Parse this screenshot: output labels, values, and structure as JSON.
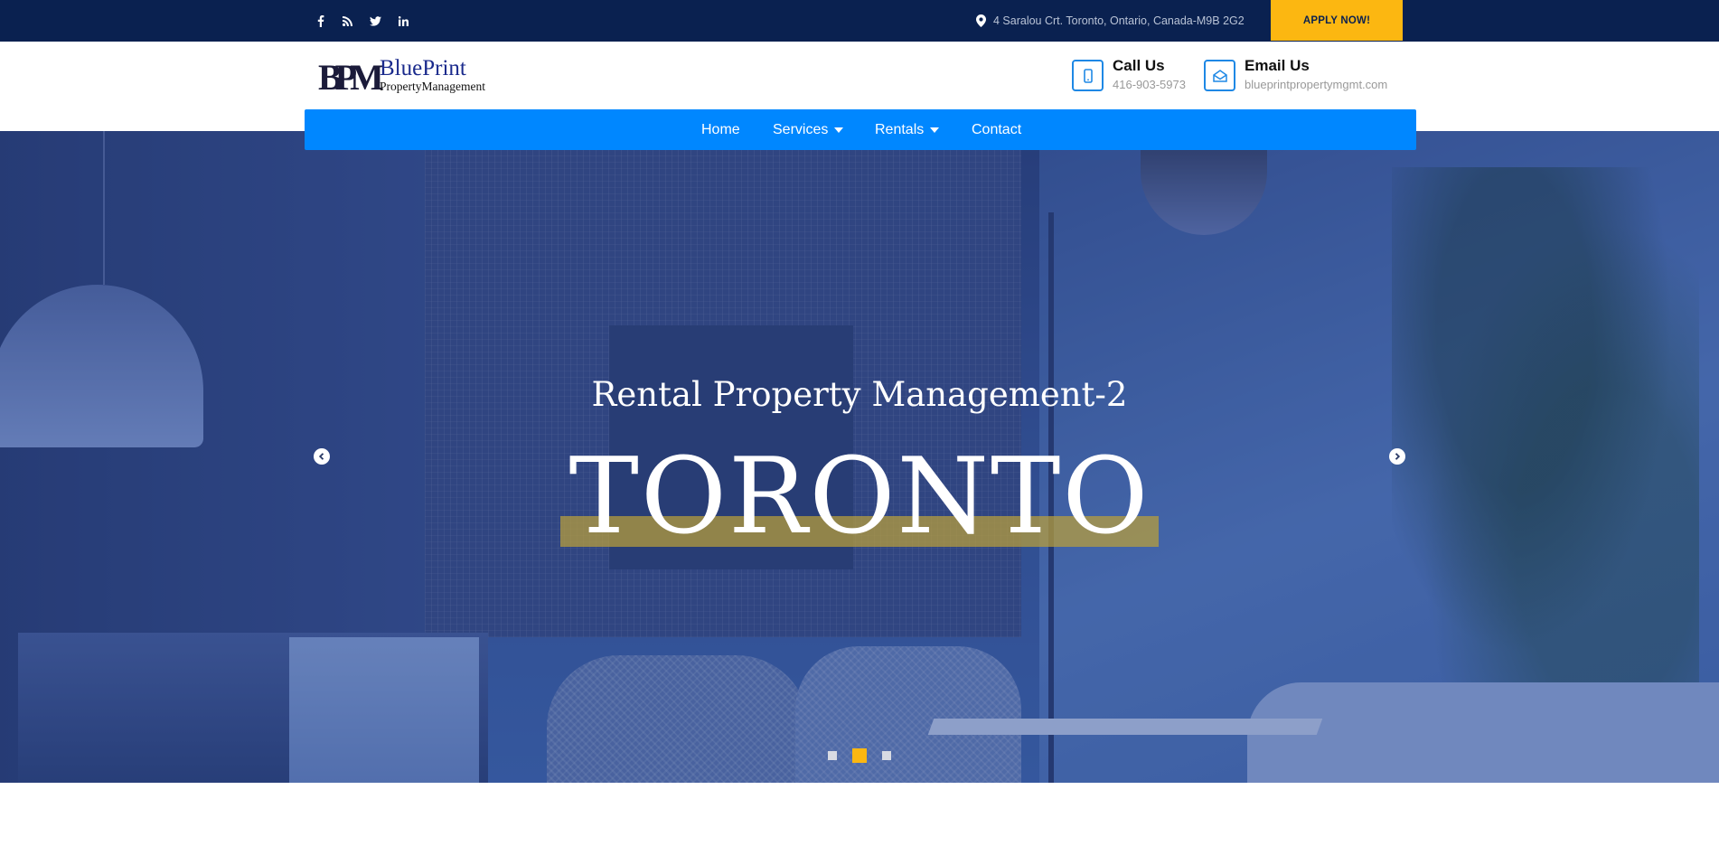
{
  "topbar": {
    "social": [
      {
        "name": "facebook-icon",
        "glyph": "f"
      },
      {
        "name": "rss-icon",
        "glyph": "rss"
      },
      {
        "name": "twitter-icon",
        "glyph": "tw"
      },
      {
        "name": "linkedin-icon",
        "glyph": "in"
      }
    ],
    "address": "4 Saralou Crt. Toronto, Ontario, Canada-M9B 2G2",
    "apply_label": "APPLY NOW!"
  },
  "header": {
    "logo_mark": "BPM",
    "logo_name": "BluePrint",
    "logo_sub": "PropertyManagement",
    "call_title": "Call Us",
    "call_value": "416-903-5973",
    "email_title": "Email Us",
    "email_value": "blueprintpropertymgmt.com"
  },
  "nav": {
    "items": [
      {
        "label": "Home",
        "dropdown": false
      },
      {
        "label": "Services",
        "dropdown": true
      },
      {
        "label": "Rentals",
        "dropdown": true
      },
      {
        "label": "Contact",
        "dropdown": false
      }
    ]
  },
  "hero": {
    "subtitle": "Rental Property Management-2",
    "title": "TORONTO",
    "slides": 3,
    "active_slide": 2
  },
  "colors": {
    "topbar_bg": "#0a2150",
    "accent_yellow": "#fcb711",
    "nav_blue": "#0087ff",
    "icon_blue": "#1e88e5"
  }
}
